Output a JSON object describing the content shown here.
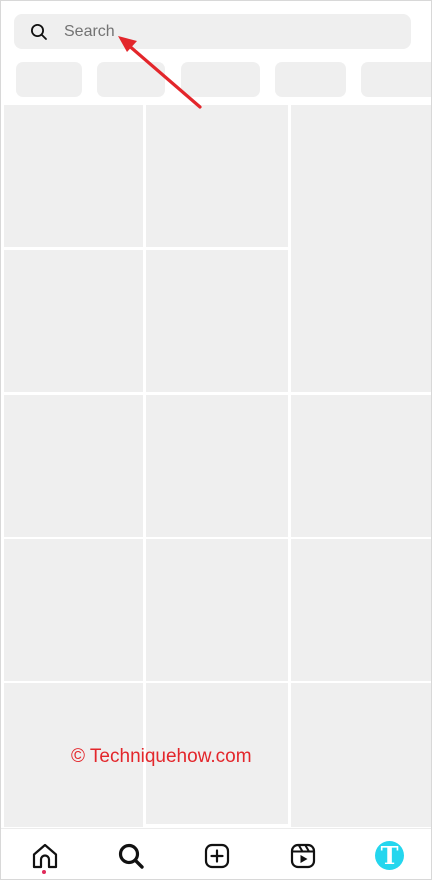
{
  "search": {
    "placeholder": "Search",
    "icon": "search-icon"
  },
  "category_chips": [
    {
      "label": ""
    },
    {
      "label": ""
    },
    {
      "label": ""
    },
    {
      "label": ""
    },
    {
      "label": ""
    }
  ],
  "explore_grid": {
    "rows": 5,
    "columns": 3,
    "tile_color": "#efefef"
  },
  "watermark": {
    "text": "© Techniquehow.com",
    "color": "#e3262b"
  },
  "annotation_arrow": {
    "color": "#e3262b",
    "points_to": "search-input"
  },
  "bottom_nav": {
    "items": [
      {
        "name": "home",
        "icon": "home-icon",
        "active": true,
        "has_notification_dot": true
      },
      {
        "name": "search",
        "icon": "search-icon",
        "active": true
      },
      {
        "name": "create",
        "icon": "plus-square-icon"
      },
      {
        "name": "reels",
        "icon": "reels-icon"
      },
      {
        "name": "profile",
        "icon": "avatar",
        "avatar_letter": "T",
        "avatar_color": "#24d6ee"
      }
    ]
  }
}
